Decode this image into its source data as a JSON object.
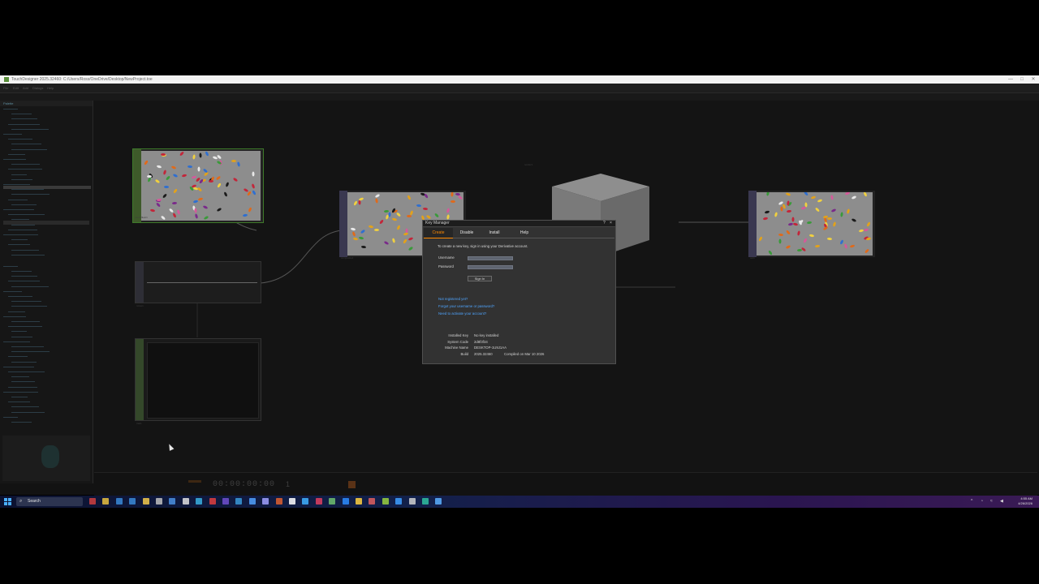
{
  "window": {
    "title": "TouchDesigner 2025.32460: C:/Users/Ross/OneDrive/Desktop/NewProject.toe",
    "minimize": "—",
    "maximize": "□",
    "close": "✕"
  },
  "menu_bar": {
    "items": [
      "File",
      "Edit",
      "Add",
      "Dialogs",
      "Help"
    ]
  },
  "palette": {
    "title": "Palette"
  },
  "network": {
    "nodes": {
      "moviefilein1": "moviefilein1",
      "noise1": "noise1",
      "trail1": "trail1",
      "composite1": "composite1",
      "render1": "render1",
      "out1": "out1"
    }
  },
  "timeline": {
    "timecode": "00:00:00:00",
    "frame": "1"
  },
  "key_manager": {
    "title": "Key Manager",
    "help_button": "?",
    "close_button": "×",
    "tabs": [
      "Create",
      "Disable",
      "Install",
      "Help"
    ],
    "active_tab": "Create",
    "intro": "To create a new key, sign in using your Derivative account.",
    "username_label": "Username",
    "password_label": "Password",
    "username_value": "",
    "password_value": "",
    "sign_in": "Sign In",
    "links": {
      "not_registered": "Not registered yet?",
      "forgot": "Forgot your username or password?",
      "activate": "Need to activate your account?"
    },
    "info": {
      "installed_key_label": "Installed Key",
      "installed_key_value": "No key installed",
      "system_code_label": "System Code",
      "system_code_value": "2d8f3f34",
      "machine_name_label": "Machine Name",
      "machine_name_value": "DESKTOP-1U9J1AA",
      "build_label": "Build",
      "build_value": "2025.32460",
      "compiled_value": "Compiled on Mar 10 2026"
    }
  },
  "taskbar": {
    "search_label": "Search",
    "time": "4:55 AM",
    "date": "4/26/2026"
  },
  "colors": {
    "accent_orange": "#ff8a00",
    "link_blue": "#4fa5ff",
    "node_green": "#3e7a2a"
  }
}
